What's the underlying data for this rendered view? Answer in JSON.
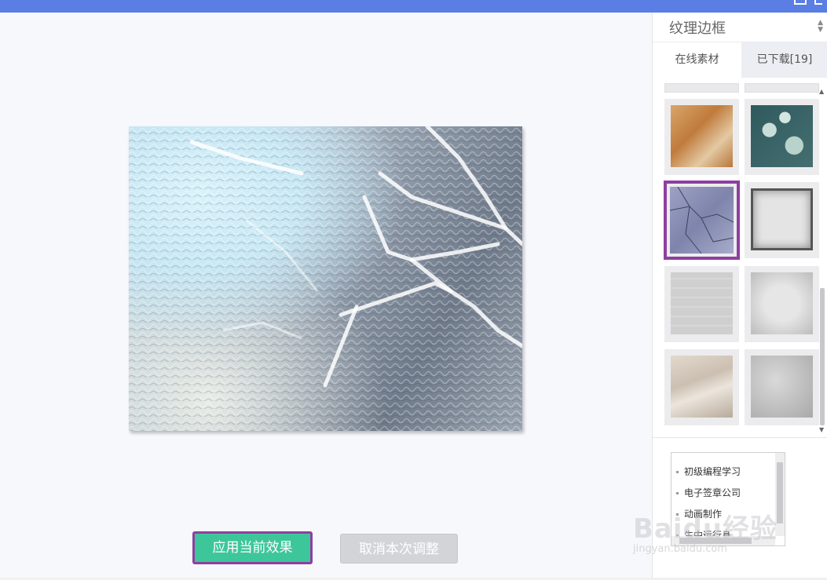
{
  "sidebar": {
    "dropdown_label": "纹理边框",
    "tabs": [
      {
        "label": "在线素材"
      },
      {
        "label": "已下载[19]"
      }
    ],
    "textures": [
      {
        "name": "orange-marble-texture",
        "color": "#c98f4f"
      },
      {
        "name": "teal-patina-texture",
        "color": "#3c6b6e"
      },
      {
        "name": "blue-cracked-stone-texture",
        "color": "#8b91b6",
        "selected": true
      },
      {
        "name": "gray-frame-texture",
        "color": "#d6d6d6"
      },
      {
        "name": "gray-wood-texture",
        "color": "#cfcfcf"
      },
      {
        "name": "light-gray-grunge-texture",
        "color": "#d9d9d9"
      },
      {
        "name": "beige-stone-texture",
        "color": "#d8cfc4"
      },
      {
        "name": "gray-concrete-texture",
        "color": "#c3c3c3"
      }
    ],
    "links": [
      "初级编程学习",
      "电子签章公司",
      "动画制作",
      "生中运行身"
    ]
  },
  "actions": {
    "apply_label": "应用当前效果",
    "cancel_label": "取消本次调整"
  },
  "watermark": {
    "main": "Baidu经验",
    "sub": "jingyan.baidu.com"
  },
  "colors": {
    "topbar": "#5a7ee3",
    "apply": "#3ec69b",
    "highlight": "#8e3fa0"
  }
}
